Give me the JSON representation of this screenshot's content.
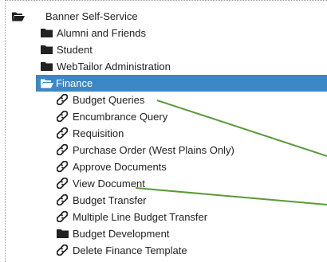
{
  "tree": {
    "root": {
      "label": "Banner Self-Service",
      "icon": "folder-open-icon"
    },
    "items": [
      {
        "label": "Alumni and Friends",
        "icon": "folder-icon"
      },
      {
        "label": "Student",
        "icon": "folder-icon"
      },
      {
        "label": "WebTailor Administration",
        "icon": "folder-icon"
      },
      {
        "label": "Finance",
        "icon": "folder-open-icon",
        "selected": true
      }
    ],
    "finance_children": [
      {
        "label": "Budget Queries",
        "icon": "link-icon"
      },
      {
        "label": "Encumbrance Query",
        "icon": "link-icon"
      },
      {
        "label": "Requisition",
        "icon": "link-icon"
      },
      {
        "label": "Purchase Order (West Plains Only)",
        "icon": "link-icon"
      },
      {
        "label": "Approve Documents",
        "icon": "link-icon"
      },
      {
        "label": "View Document",
        "icon": "link-icon"
      },
      {
        "label": "Budget Transfer",
        "icon": "link-icon"
      },
      {
        "label": "Multiple Line Budget Transfer",
        "icon": "link-icon"
      },
      {
        "label": "Budget Development",
        "icon": "folder-icon"
      },
      {
        "label": "Delete Finance Template",
        "icon": "link-icon"
      }
    ]
  },
  "colors": {
    "selection": "#3d87c7",
    "annotation_line": "#5a9a3a",
    "folder_icon": "#222222"
  }
}
